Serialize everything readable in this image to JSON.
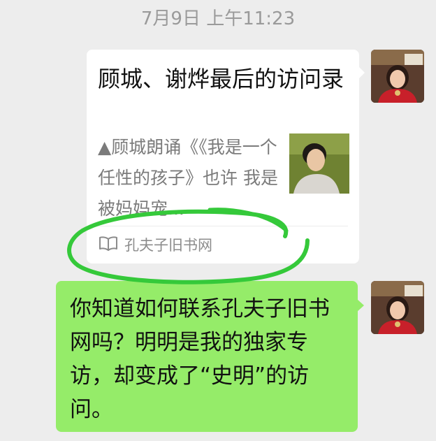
{
  "timestamp": "7月9日 上午11:23",
  "messages": [
    {
      "type": "link_card",
      "sender": "self",
      "avatar_icon": "user-avatar",
      "title": "顾城、谢烨最后的访问录",
      "description": "▲顾城朗诵《《我是一个任性的孩子》也许 我是被妈妈宠...",
      "thumbnail": "portrait-photo",
      "source_icon": "book-icon",
      "source_name": "孔夫子旧书网"
    },
    {
      "type": "text",
      "sender": "self",
      "avatar_icon": "user-avatar",
      "text": "你知道如何联系孔夫子旧书网吗？明明是我的独家专访，却变成了“史明”的访问。"
    }
  ],
  "colors": {
    "background": "#ededed",
    "bubble_green": "#95ec69",
    "card_white": "#ffffff",
    "scribble_green": "#35c93a"
  }
}
